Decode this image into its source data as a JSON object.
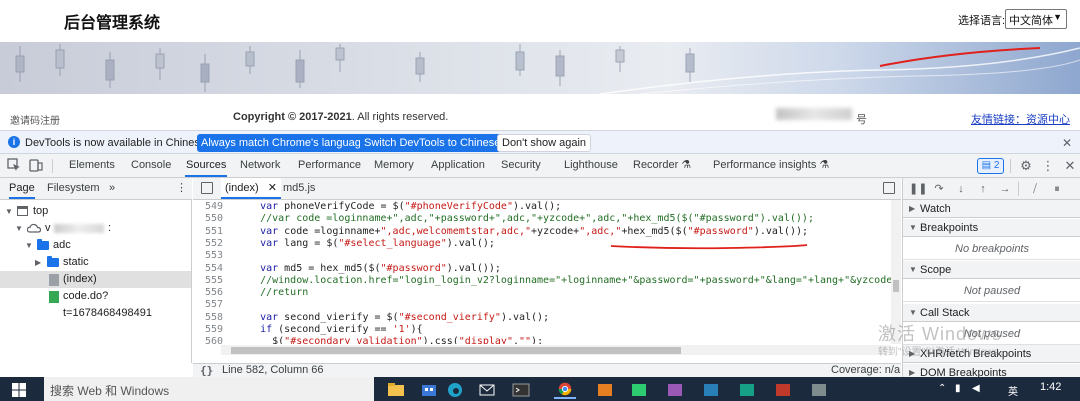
{
  "site": {
    "title": "后台管理系统",
    "lang_label": "选择语言:",
    "lang_value": "中文简体",
    "footer_left_link": "邀请码注册",
    "copyright_prefix": "Copyright © 2017-2021",
    "copyright_suffix": ". All rights reserved.",
    "footer_hao": "号",
    "footer_right_link": "友情链接：资源中心"
  },
  "infobar": {
    "message": "DevTools is now available in Chinese!",
    "btn_match": "Always match Chrome's language",
    "btn_switch": "Switch DevTools to Chinese",
    "btn_dismiss": "Don't show again"
  },
  "tabs": [
    {
      "label": "Elements"
    },
    {
      "label": "Console"
    },
    {
      "label": "Sources"
    },
    {
      "label": "Network"
    },
    {
      "label": "Performance"
    },
    {
      "label": "Memory"
    },
    {
      "label": "Application"
    },
    {
      "label": "Security"
    },
    {
      "label": "Lighthouse"
    },
    {
      "label": "Recorder ⚗"
    },
    {
      "label": "Performance insights ⚗"
    }
  ],
  "issues_count": "2",
  "nav": {
    "tab_page": "Page",
    "tab_filesystem": "Filesystem",
    "more": "»",
    "tree": {
      "top": "top",
      "host": "v",
      "host_suffix": ":",
      "adc": "adc",
      "static": "static",
      "index": "(index)",
      "code_file": "code.do?t=1678468498491"
    }
  },
  "editor": {
    "tab_index": "(index)",
    "tab_md5": "md5.js",
    "lines": [
      {
        "n": "549",
        "code": "    var phoneVerifyCode = $(\"#phoneVerifyCode\").val();"
      },
      {
        "n": "550",
        "code": "    //var code =loginname+\",adc,\"+password+\",adc,\"+yzcode+\",adc,\"+hex_md5($(\"#password\").val());"
      },
      {
        "n": "551",
        "code": "    var code =loginname+\",adc,welcomemtstar,adc,\"+yzcode+\",adc,\"+hex_md5($(\"#password\").val());"
      },
      {
        "n": "552",
        "code": "    var lang = $(\"#select_language\").val();"
      },
      {
        "n": "553",
        "code": ""
      },
      {
        "n": "554",
        "code": "    var md5 = hex_md5($(\"#password\").val());"
      },
      {
        "n": "555",
        "code": "    //window.location.href=\"login_login_v2?loginname=\"+loginname+\"&password=\"+password+\"&lang=\"+lang+\"&yzcode=\"+yzc"
      },
      {
        "n": "556",
        "code": "    //return"
      },
      {
        "n": "557",
        "code": ""
      },
      {
        "n": "558",
        "code": "    var second_vierify = $(\"#second_vierify\").val();"
      },
      {
        "n": "559",
        "code": "    if (second_vierify == '1'){"
      },
      {
        "n": "560",
        "code": "      $(\"#secondary_validation\").css(\"display\",\"\");"
      }
    ]
  },
  "status": {
    "curly": "{}",
    "position": "Line 582, Column 66",
    "coverage": "Coverage: n/a"
  },
  "debugger": {
    "watch": "Watch",
    "breakpoints": "Breakpoints",
    "no_breakpoints": "No breakpoints",
    "scope": "Scope",
    "not_paused": "Not paused",
    "call_stack": "Call Stack",
    "not_paused_2": "Not paused",
    "xhr": "XHR/fetch Breakpoints",
    "dom": "DOM Breakpoints"
  },
  "watermark": {
    "line1": "激活 Windows",
    "line2": "转到\"设置\"以激活 Windows。"
  },
  "taskbar": {
    "search_placeholder": "搜索 Web 和 Windows",
    "time": "1:42",
    "ime": "英"
  },
  "colors": {
    "accent": "#1a73e8",
    "keyword": "#1a1aa6",
    "string": "#c41a16",
    "comment": "#236e25",
    "annotation_red": "#e0201a"
  }
}
